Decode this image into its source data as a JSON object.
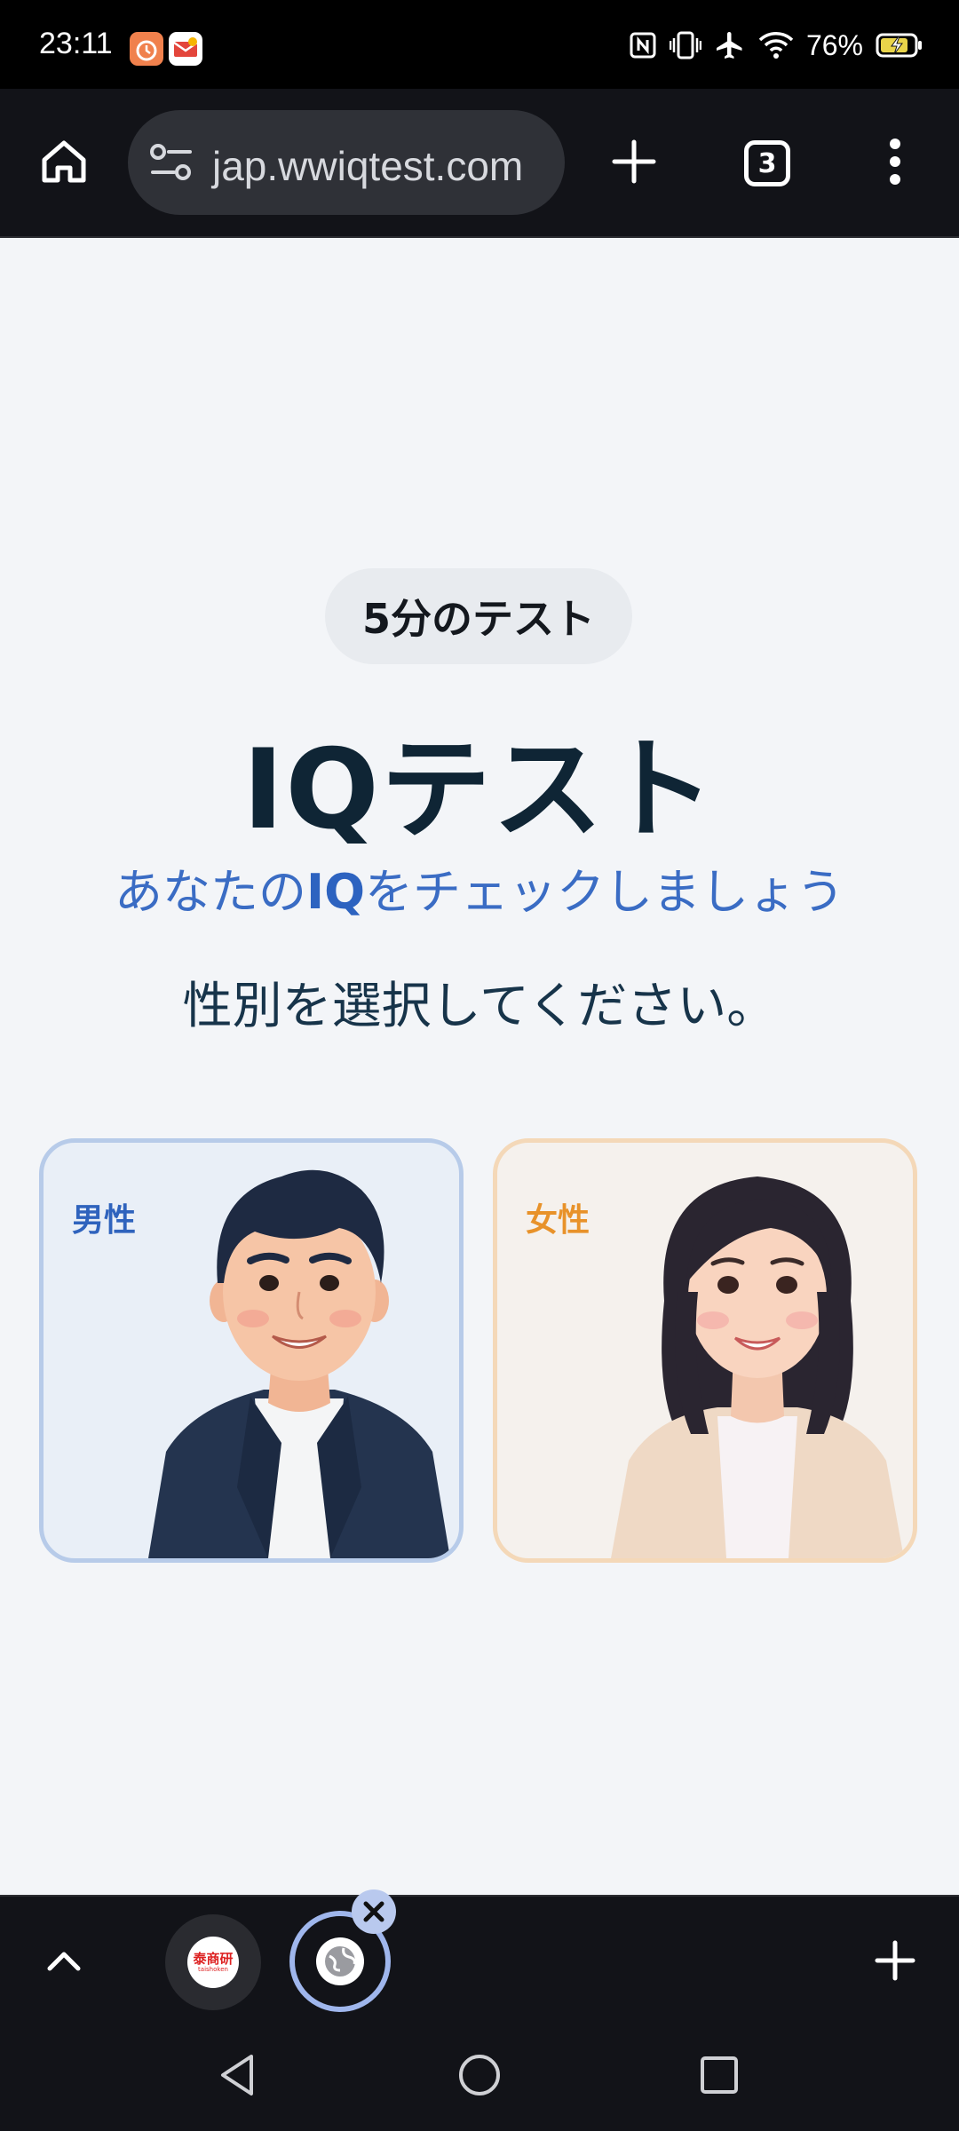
{
  "status_bar": {
    "time": "23:11",
    "battery": "76%",
    "icons": [
      "alarm-icon",
      "mail-app-icon",
      "nfc-icon",
      "vibrate-icon",
      "airplane-icon",
      "wifi-icon",
      "battery-charging-icon"
    ]
  },
  "toolbar": {
    "url": "jap.wwiqtest.com",
    "tab_count": "3",
    "icons": [
      "home-icon",
      "site-settings-icon",
      "plus-icon",
      "more-vert-icon"
    ]
  },
  "page": {
    "pill": "5分のテスト",
    "title": "IQテスト",
    "subtitle_before": "あなたの",
    "subtitle_bold": "IQ",
    "subtitle_after": "をチェックしましょう",
    "prompt": "性別を選択してください。",
    "male_label": "男性",
    "female_label": "女性"
  },
  "tab_strip": {
    "tab1_favicon_text": "泰商研",
    "tab1_favicon_sub": "taishoken",
    "icons": [
      "chevron-up-icon",
      "close-icon",
      "plus-icon"
    ]
  },
  "colors": {
    "accent_blue": "#2d63c0",
    "accent_orange": "#e8922a",
    "title": "#0f2535",
    "background": "#f3f5f8"
  }
}
